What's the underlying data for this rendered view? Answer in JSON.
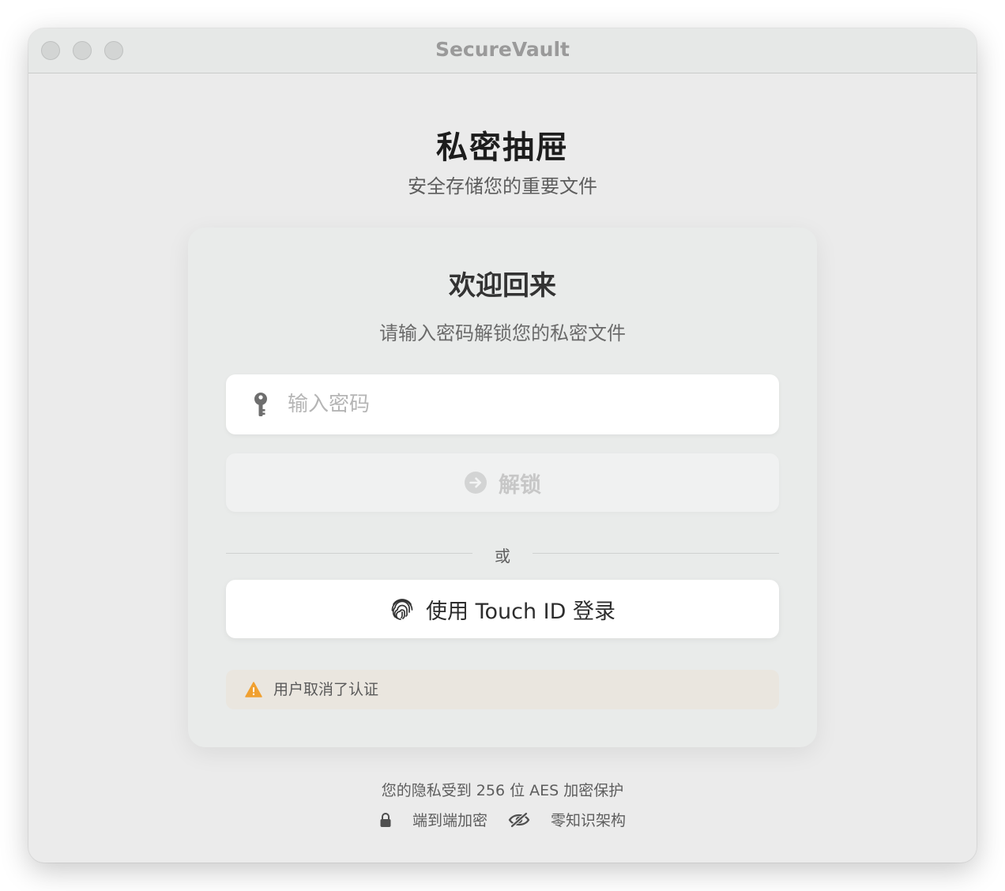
{
  "window": {
    "title": "SecureVault"
  },
  "header": {
    "title": "私密抽屉",
    "subtitle": "安全存储您的重要文件"
  },
  "card": {
    "title": "欢迎回来",
    "subtitle": "请输入密码解锁您的私密文件",
    "password": {
      "placeholder": "输入密码",
      "value": "",
      "icon": "key-icon"
    },
    "unlock_button": {
      "label": "解锁",
      "icon": "arrow-right-circle-icon",
      "enabled": false
    },
    "divider_text": "或",
    "touchid_button": {
      "label": "使用 Touch ID 登录",
      "icon": "fingerprint-icon"
    },
    "alert": {
      "text": "用户取消了认证",
      "icon": "warning-icon",
      "color": "#f0a030"
    }
  },
  "footer": {
    "note": "您的隐私受到 256 位 AES 加密保护",
    "features": [
      {
        "icon": "lock-icon",
        "label": "端到端加密"
      },
      {
        "icon": "eye-slash-icon",
        "label": "零知识架构"
      }
    ]
  },
  "colors": {
    "window_bg": "#ebebeb",
    "card_bg": "#e9ebea",
    "alert_bg": "#eae6df"
  }
}
